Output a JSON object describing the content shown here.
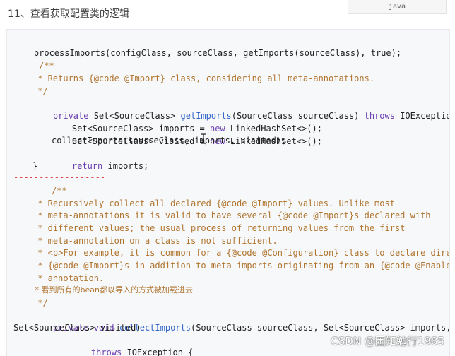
{
  "section": {
    "heading": "11、查看获取配置类的逻辑",
    "language_tag": "java"
  },
  "code": {
    "line_01": "processImports(configClass, sourceClass, getImports(sourceClass), true);",
    "line_02_comment_open": "/**",
    "line_03_javadoc": " * Returns {@code @Import} class, considering all meta-annotations.",
    "line_04_comment_close": " */",
    "line_05_private": "private ",
    "line_05_type": "Set<SourceClass> ",
    "line_05_method": "getImports",
    "line_05_params": "(SourceClass sourceClass) ",
    "line_05_throws": "throws ",
    "line_05_rest": "IOException {",
    "line_06_pre": "Set<SourceClass> imports = ",
    "line_06_new": "new ",
    "line_06_post": "LinkedHashSet<>();",
    "line_07_pre": "Set<SourceClass> visited = ",
    "line_07_new": "new ",
    "line_07_post": "LinkedHashSet<>();",
    "line_08": "collectImports(sourceClass, imports, visited);",
    "line_09_return": "return ",
    "line_09_rest": "imports;",
    "line_10": "}",
    "separator": "------------------",
    "line_12": "/**",
    "line_13": " * Recursively collect all declared {@code @Import} values. Unlike most",
    "line_14": " * meta-annotations it is valid to have several {@code @Import}s declared with",
    "line_15": " * different values; the usual process of returning values from the first",
    "line_16": " * meta-annotation on a class is not sufficient.",
    "line_17": " * <p>For example, it is common for a {@code @Configuration} class to declare direct",
    "line_18": " * {@code @Import}s in addition to meta-imports originating from an {@code @Enable}",
    "line_19": " * annotation.",
    "line_20": " * 看到所有的bean都以导入的方式被加载进去",
    "line_21": " */",
    "line_22_private": "private ",
    "line_22_void": "void ",
    "line_22_method": "collectImports",
    "line_22_rest": "(SourceClass sourceClass, Set<SourceClass> imports,",
    "line_23": "Set<SourceClass> visited)",
    "line_24_throws": "throws ",
    "line_24_rest": "IOException {"
  },
  "watermark": "CSDN @困知勉行1985",
  "colors": {
    "comment": "#b0742e",
    "keyword": "#6a3fb0",
    "method": "#3465c9",
    "separator": "#e04343",
    "code_background": "#f6f8fa"
  },
  "icons": {
    "cursor": "text-cursor-ibeam-icon"
  }
}
